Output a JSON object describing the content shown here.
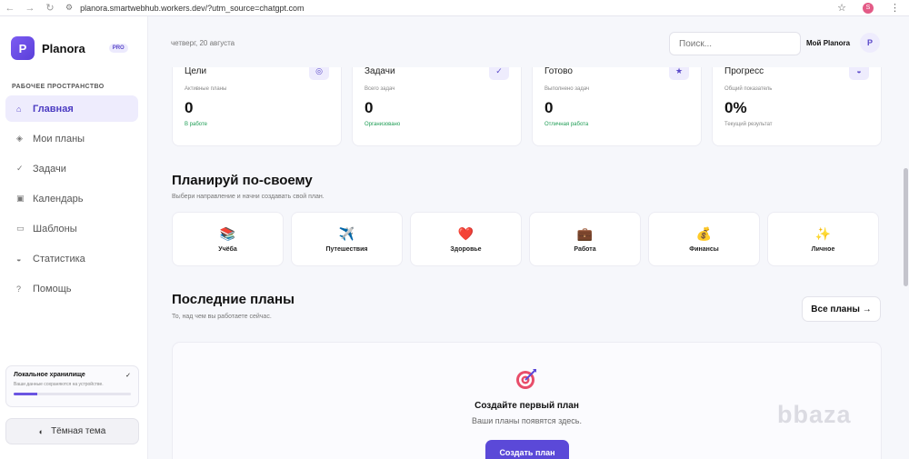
{
  "browser": {
    "url": "planora.smartwebhub.workers.dev/?utm_source=chatgpt.com",
    "profile_initial": "S"
  },
  "sidebar": {
    "brand_initial": "P",
    "brand_name": "Planora",
    "pro_badge": "PRO",
    "section_label": "РАБОЧЕЕ ПРОСТРАНСТВО",
    "items": [
      {
        "label": "Главная",
        "icon": "⌂"
      },
      {
        "label": "Мои планы",
        "icon": "◈"
      },
      {
        "label": "Задачи",
        "icon": "✓"
      },
      {
        "label": "Календарь",
        "icon": "▣"
      },
      {
        "label": "Шаблоны",
        "icon": "▭"
      },
      {
        "label": "Статистика",
        "icon": "◒"
      },
      {
        "label": "Помощь",
        "icon": "?"
      }
    ],
    "storage": {
      "title": "Локальное хранилище",
      "check": "✓",
      "subtitle": "Ваши данные сохраняются на устройстве.",
      "fill_fraction": 0.2
    },
    "theme_label": "Тёмная тема",
    "theme_icon": "◐"
  },
  "topbar": {
    "date": "четверг, 20 августа",
    "search_placeholder": "Поиск...",
    "user_name": "Мой Planora",
    "user_initial": "P"
  },
  "stats": [
    {
      "title": "Цели",
      "icon": "◎",
      "sub": "Активные планы",
      "value": "0",
      "note": "В работе",
      "note_color": "green"
    },
    {
      "title": "Задачи",
      "icon": "✓",
      "sub": "Всего задач",
      "value": "0",
      "note": "Организовано",
      "note_color": "green"
    },
    {
      "title": "Готово",
      "icon": "★",
      "sub": "Выполнено задач",
      "value": "0",
      "note": "Отличная работа",
      "note_color": "green"
    },
    {
      "title": "Прогресс",
      "icon": "◒",
      "sub": "Общий показатель",
      "value": "0%",
      "note": "Текущий результат",
      "note_color": "muted"
    }
  ],
  "directions": {
    "title": "Планируй по-своему",
    "subtitle": "Выбери направление и начни создавать свой план.",
    "items": [
      {
        "label": "Учёба",
        "emoji": "📚"
      },
      {
        "label": "Путешествия",
        "emoji": "✈️"
      },
      {
        "label": "Здоровье",
        "emoji": "❤️"
      },
      {
        "label": "Работа",
        "emoji": "💼"
      },
      {
        "label": "Финансы",
        "emoji": "💰"
      },
      {
        "label": "Личное",
        "emoji": "✨"
      }
    ]
  },
  "recent": {
    "title": "Последние планы",
    "subtitle": "То, над чем вы работаете сейчас.",
    "all_button": "Все планы →",
    "empty_title": "Создайте первый план",
    "empty_sub": "Ваши планы появятся здесь.",
    "create_button": "Создать план"
  },
  "watermark": "bbaza",
  "colors": {
    "accent": "#5b49d8",
    "accent_light": "#eeecfd",
    "green": "#1f9d55"
  }
}
